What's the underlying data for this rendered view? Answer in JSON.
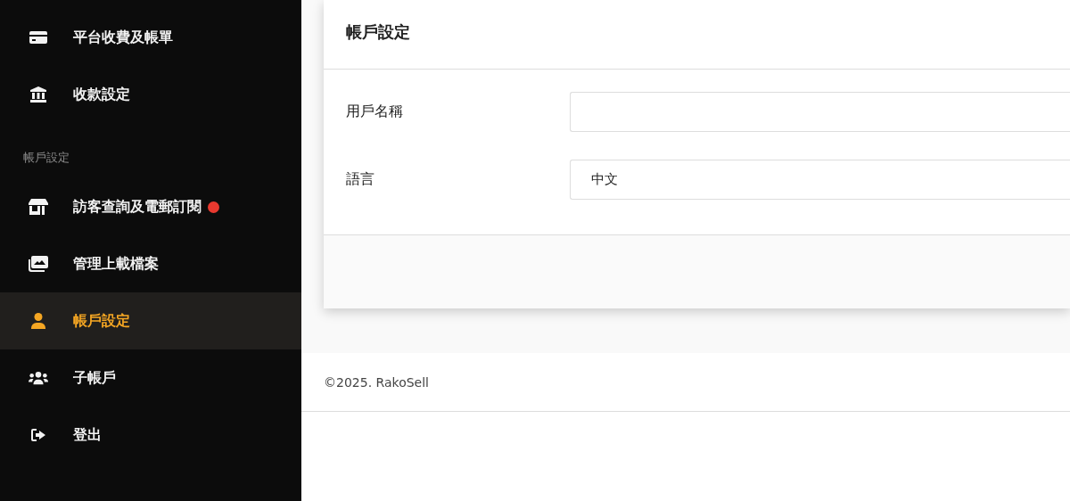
{
  "sidebar": {
    "items": [
      {
        "kind": "link",
        "label": "平台收費及帳單",
        "selected": false,
        "notification": false
      },
      {
        "kind": "link",
        "label": "收款設定",
        "selected": false,
        "notification": false
      },
      {
        "kind": "section",
        "label": "帳戶設定"
      },
      {
        "kind": "link",
        "label": "訪客查詢及電郵訂閱",
        "selected": false,
        "notification": true
      },
      {
        "kind": "link",
        "label": "管理上載檔案",
        "selected": false,
        "notification": false
      },
      {
        "kind": "link",
        "label": "帳戶設定",
        "selected": true,
        "notification": false
      },
      {
        "kind": "link",
        "label": "子帳戶",
        "selected": false,
        "notification": false
      },
      {
        "kind": "link",
        "label": "登出",
        "selected": false,
        "notification": false
      }
    ]
  },
  "card": {
    "title": "帳戶設定",
    "fields": [
      {
        "label": "用戶名稱"
      },
      {
        "label": "語言",
        "value": "中文"
      }
    ]
  },
  "footer": {
    "copyright": "©2025. RakoSell"
  }
}
